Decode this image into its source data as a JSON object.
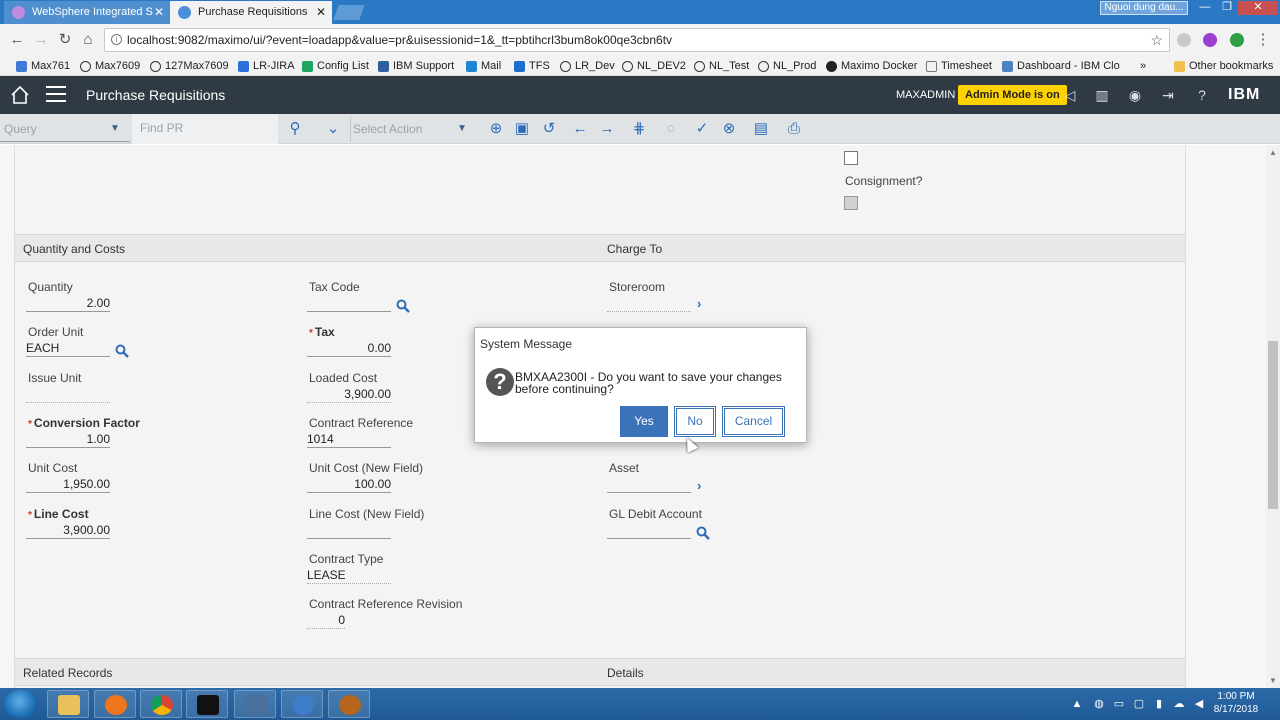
{
  "browser": {
    "tabs": [
      {
        "title": "WebSphere Integrated S",
        "active": false
      },
      {
        "title": "Purchase Requisitions",
        "active": true
      }
    ],
    "window_user": "Nguoi dung dau...",
    "url": "localhost:9082/maximo/ui/?event=loadapp&value=pr&uisessionid=1&_tt=pbtihcrl3bum8ok00qe3cbn6tv",
    "bookmarks": [
      "Max761",
      "Max7609",
      "127Max7609",
      "LR-JIRA",
      "Config List",
      "IBM Support",
      "Mail",
      "TFS",
      "LR_Dev",
      "NL_DEV2",
      "NL_Test",
      "NL_Prod",
      "Maximo Docker",
      "Timesheet",
      "Dashboard - IBM Clo"
    ],
    "bookmarks_overflow": "»",
    "other_bookmarks": "Other bookmarks"
  },
  "app": {
    "title": "Purchase Requisitions",
    "user": "MAXADMIN",
    "admin_badge": "Admin Mode is on",
    "brand": "IBM"
  },
  "toolbar": {
    "query_placeholder": "Query",
    "find_placeholder": "Find PR",
    "select_action_placeholder": "Select Action"
  },
  "top_area": {
    "consignment_label": "Consignment?"
  },
  "sections": {
    "quantity_costs": "Quantity and Costs",
    "charge_to": "Charge To",
    "related_records": "Related Records",
    "details": "Details"
  },
  "fields": {
    "quantity": {
      "label": "Quantity",
      "value": "2.00"
    },
    "order_unit": {
      "label": "Order Unit",
      "value": "EACH"
    },
    "issue_unit": {
      "label": "Issue Unit",
      "value": ""
    },
    "conversion_factor": {
      "label": "Conversion Factor",
      "value": "1.00"
    },
    "unit_cost": {
      "label": "Unit Cost",
      "value": "1,950.00"
    },
    "line_cost": {
      "label": "Line Cost",
      "value": "3,900.00"
    },
    "tax_code": {
      "label": "Tax Code",
      "value": ""
    },
    "tax": {
      "label": "Tax",
      "value": "0.00"
    },
    "loaded_cost": {
      "label": "Loaded Cost",
      "value": "3,900.00"
    },
    "contract_reference": {
      "label": "Contract Reference",
      "value": "1014"
    },
    "unit_cost_new": {
      "label": "Unit Cost (New Field)",
      "value": "100.00"
    },
    "line_cost_new": {
      "label": "Line Cost (New Field)",
      "value": ""
    },
    "contract_type": {
      "label": "Contract Type",
      "value": "LEASE"
    },
    "contract_ref_revision": {
      "label": "Contract Reference Revision",
      "value": "0"
    },
    "storeroom": {
      "label": "Storeroom",
      "value": ""
    },
    "asset": {
      "label": "Asset",
      "value": ""
    },
    "gl_debit": {
      "label": "GL Debit Account",
      "value": ""
    }
  },
  "dialog": {
    "title": "System Message",
    "message": "BMXAA2300I - Do you want to save your changes before continuing?",
    "yes": "Yes",
    "no": "No",
    "cancel": "Cancel"
  },
  "taskbar": {
    "time": "1:00 PM",
    "date": "8/17/2018"
  }
}
